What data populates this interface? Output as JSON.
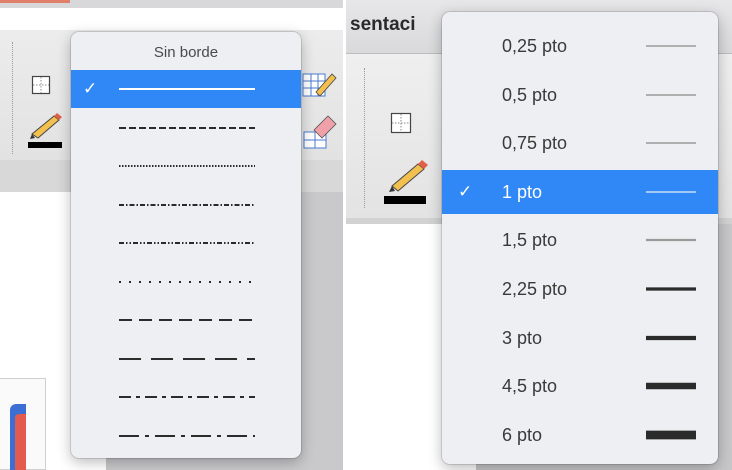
{
  "left": {
    "border_menu": {
      "header": "Sin borde",
      "items": [
        {
          "style": "solid",
          "checked": true
        },
        {
          "style": "dashed-short",
          "checked": false
        },
        {
          "style": "dotted-fine",
          "checked": false
        },
        {
          "style": "dash-dot-fine",
          "checked": false
        },
        {
          "style": "dash-dot-dot-fine",
          "checked": false
        },
        {
          "style": "dotted-sparse",
          "checked": false
        },
        {
          "style": "dashed-medium",
          "checked": false
        },
        {
          "style": "dashed-long",
          "checked": false
        },
        {
          "style": "dash-dot-medium",
          "checked": false
        },
        {
          "style": "dash-dot-long",
          "checked": false
        }
      ],
      "check_glyph": "✓"
    },
    "toolbar_icons": [
      "border-grid-icon",
      "pen-color-icon",
      "table-pencil-icon",
      "eraser-icon"
    ]
  },
  "right": {
    "window_title": "sentaci",
    "width_menu": {
      "check_glyph": "✓",
      "items": [
        {
          "label": "0,25 pto",
          "weight": 0.25,
          "checked": false
        },
        {
          "label": "0,5 pto",
          "weight": 0.5,
          "checked": false
        },
        {
          "label": "0,75 pto",
          "weight": 0.75,
          "checked": false
        },
        {
          "label": "1 pto",
          "weight": 1,
          "checked": true
        },
        {
          "label": "1,5 pto",
          "weight": 1.5,
          "checked": false
        },
        {
          "label": "2,25 pto",
          "weight": 2.25,
          "checked": false
        },
        {
          "label": "3 pto",
          "weight": 3,
          "checked": false
        },
        {
          "label": "4,5 pto",
          "weight": 4.5,
          "checked": false
        },
        {
          "label": "6 pto",
          "weight": 6,
          "checked": false
        }
      ]
    },
    "toolbar_icons": [
      "border-grid-icon",
      "pen-color-icon"
    ]
  },
  "colors": {
    "selection": "#2f88f5",
    "menu_bg": "#eeeff2",
    "line_dark": "#2b2b2b",
    "line_light": "#9a9a9a"
  }
}
